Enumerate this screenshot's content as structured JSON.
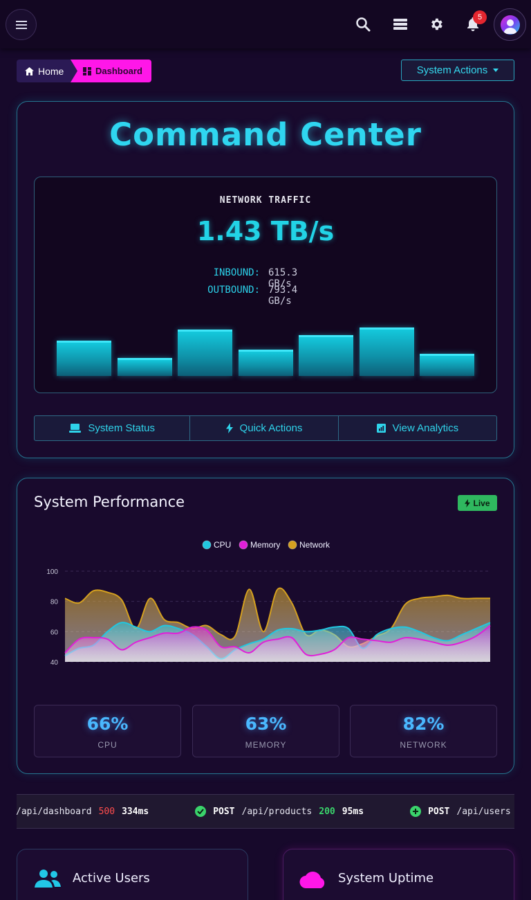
{
  "topbar": {
    "icons": [
      "menu-icon",
      "search-icon",
      "server-icon",
      "gear-icon",
      "bell-icon",
      "user-avatar"
    ],
    "notification_count": "5"
  },
  "breadcrumb": {
    "home": "Home",
    "current": "Dashboard"
  },
  "actions": {
    "system_actions": "System Actions"
  },
  "command_center": {
    "title": "Command Center",
    "traffic_label": "NETWORK TRAFFIC",
    "traffic_value": "1.43 TB/s",
    "inbound_label": "INBOUND:",
    "inbound_value": "615.3 GB/s",
    "outbound_label": "OUTBOUND:",
    "outbound_value": "793.4 GB/s",
    "bar_levels": [
      0.7,
      0.36,
      0.92,
      0.52,
      0.81,
      0.96,
      0.44
    ],
    "buttons": {
      "status": "System Status",
      "quick": "Quick Actions",
      "analytics": "View Analytics"
    }
  },
  "performance": {
    "title": "System Performance",
    "live": "Live",
    "stats": [
      {
        "value": "66%",
        "label": "CPU"
      },
      {
        "value": "63%",
        "label": "MEMORY"
      },
      {
        "value": "82%",
        "label": "NETWORK"
      }
    ]
  },
  "chart_data": {
    "type": "area",
    "ylim": [
      40,
      100
    ],
    "yticks": [
      40,
      60,
      80,
      100
    ],
    "legend_placement": "top-center",
    "grid": true,
    "series": [
      {
        "name": "CPU",
        "color": "#22c7e0",
        "values": [
          44,
          49,
          51,
          60,
          66,
          63,
          60,
          64,
          62,
          58,
          50,
          42,
          48,
          52,
          55,
          61,
          62,
          60,
          61,
          63,
          62,
          49,
          58,
          62,
          63,
          60,
          56,
          54,
          58,
          62,
          66
        ]
      },
      {
        "name": "Memory",
        "color": "#e020d8",
        "values": [
          46,
          55,
          56,
          55,
          48,
          53,
          56,
          59,
          59,
          63,
          61,
          50,
          50,
          46,
          53,
          55,
          56,
          45,
          45,
          48,
          56,
          55,
          54,
          53,
          56,
          55,
          53,
          51,
          53,
          57,
          64
        ]
      },
      {
        "name": "Network",
        "color": "#d4a020",
        "values": [
          82,
          79,
          87,
          86,
          81,
          62,
          82,
          68,
          66,
          62,
          64,
          58,
          57,
          88,
          60,
          88,
          79,
          58,
          61,
          58,
          50,
          52,
          57,
          62,
          78,
          82,
          83,
          84,
          82,
          82,
          82
        ]
      }
    ]
  },
  "ticker": [
    {
      "method": "",
      "path": "/api/dashboard",
      "status": "500",
      "time": "334ms",
      "ok": false
    },
    {
      "method": "POST",
      "path": "/api/products",
      "status": "200",
      "time": "95ms",
      "ok": true
    },
    {
      "method": "POST",
      "path": "/api/users",
      "status": "",
      "time": "",
      "ok": true
    }
  ],
  "bottom": {
    "active_users": "Active Users",
    "uptime": "System Uptime"
  }
}
